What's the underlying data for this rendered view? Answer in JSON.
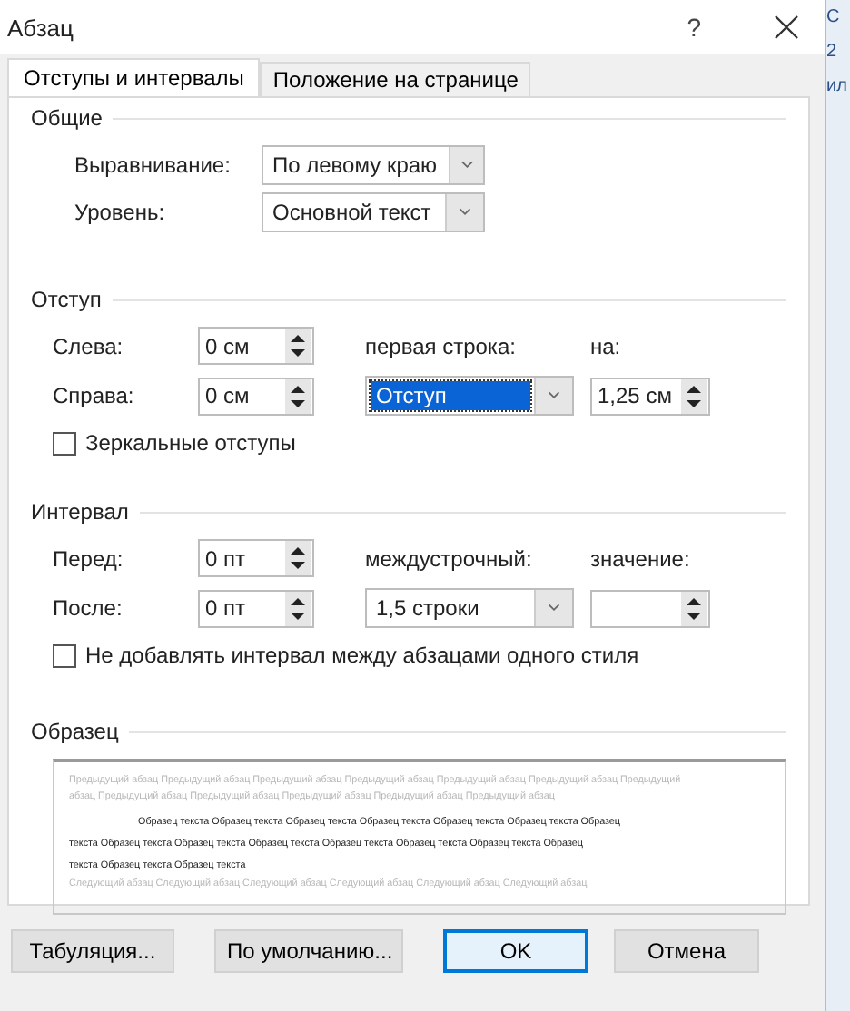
{
  "window": {
    "title": "Абзац",
    "help": "?"
  },
  "tabs": [
    {
      "label": "Отступы и интервалы",
      "selected": true
    },
    {
      "label": "Положение на странице",
      "selected": false
    }
  ],
  "general": {
    "title": "Общие",
    "fields": [
      {
        "label": "Выравнивание:",
        "value": "По левому краю"
      },
      {
        "label": "Уровень:",
        "value": "Основной текст"
      }
    ]
  },
  "indent": {
    "title": "Отступ",
    "left": {
      "label": "Слева:",
      "value": "0 см"
    },
    "right": {
      "label": "Справа:",
      "value": "0 см"
    },
    "first_line": {
      "label": "первая строка:",
      "value": "Отступ",
      "highlighted": true
    },
    "by": {
      "label": "на:",
      "value": "1,25 см"
    },
    "mirror": {
      "label": "Зеркальные отступы",
      "checked": false
    }
  },
  "spacing": {
    "title": "Интервал",
    "before": {
      "label": "Перед:",
      "value": "0 пт"
    },
    "after": {
      "label": "После:",
      "value": "0 пт"
    },
    "line": {
      "label": "междустрочный:",
      "value": "1,5 строки"
    },
    "at": {
      "label": "значение:"
    },
    "no_space": {
      "label": "Не добавлять интервал между абзацами одного стиля",
      "checked": false
    }
  },
  "preview": {
    "title": "Образец",
    "previous_lines": [
      "Предыдущий абзац Предыдущий абзац Предыдущий абзац Предыдущий абзац Предыдущий абзац Предыдущий абзац Предыдущий",
      "абзац Предыдущий абзац Предыдущий абзац Предыдущий абзац Предыдущий абзац Предыдущий абзац"
    ],
    "sample_lines": [
      "Образец текста Образец текста Образец текста Образец текста Образец текста Образец текста Образец",
      "текста Образец текста Образец текста Образец текста Образец текста Образец текста Образец текста Образец",
      "текста Образец текста Образец текста"
    ],
    "next_lines": [
      "Следующий абзац Следующий абзац Следующий абзац Следующий абзац Следующий абзац Следующий абзац"
    ]
  },
  "buttons": [
    {
      "label": "Табуляция...",
      "default": false
    },
    {
      "label": "По умолчанию...",
      "default": false
    },
    {
      "label": "OK",
      "default": true
    },
    {
      "label": "Отмена",
      "default": false
    }
  ],
  "background": [
    "С",
    "2",
    "ил"
  ]
}
